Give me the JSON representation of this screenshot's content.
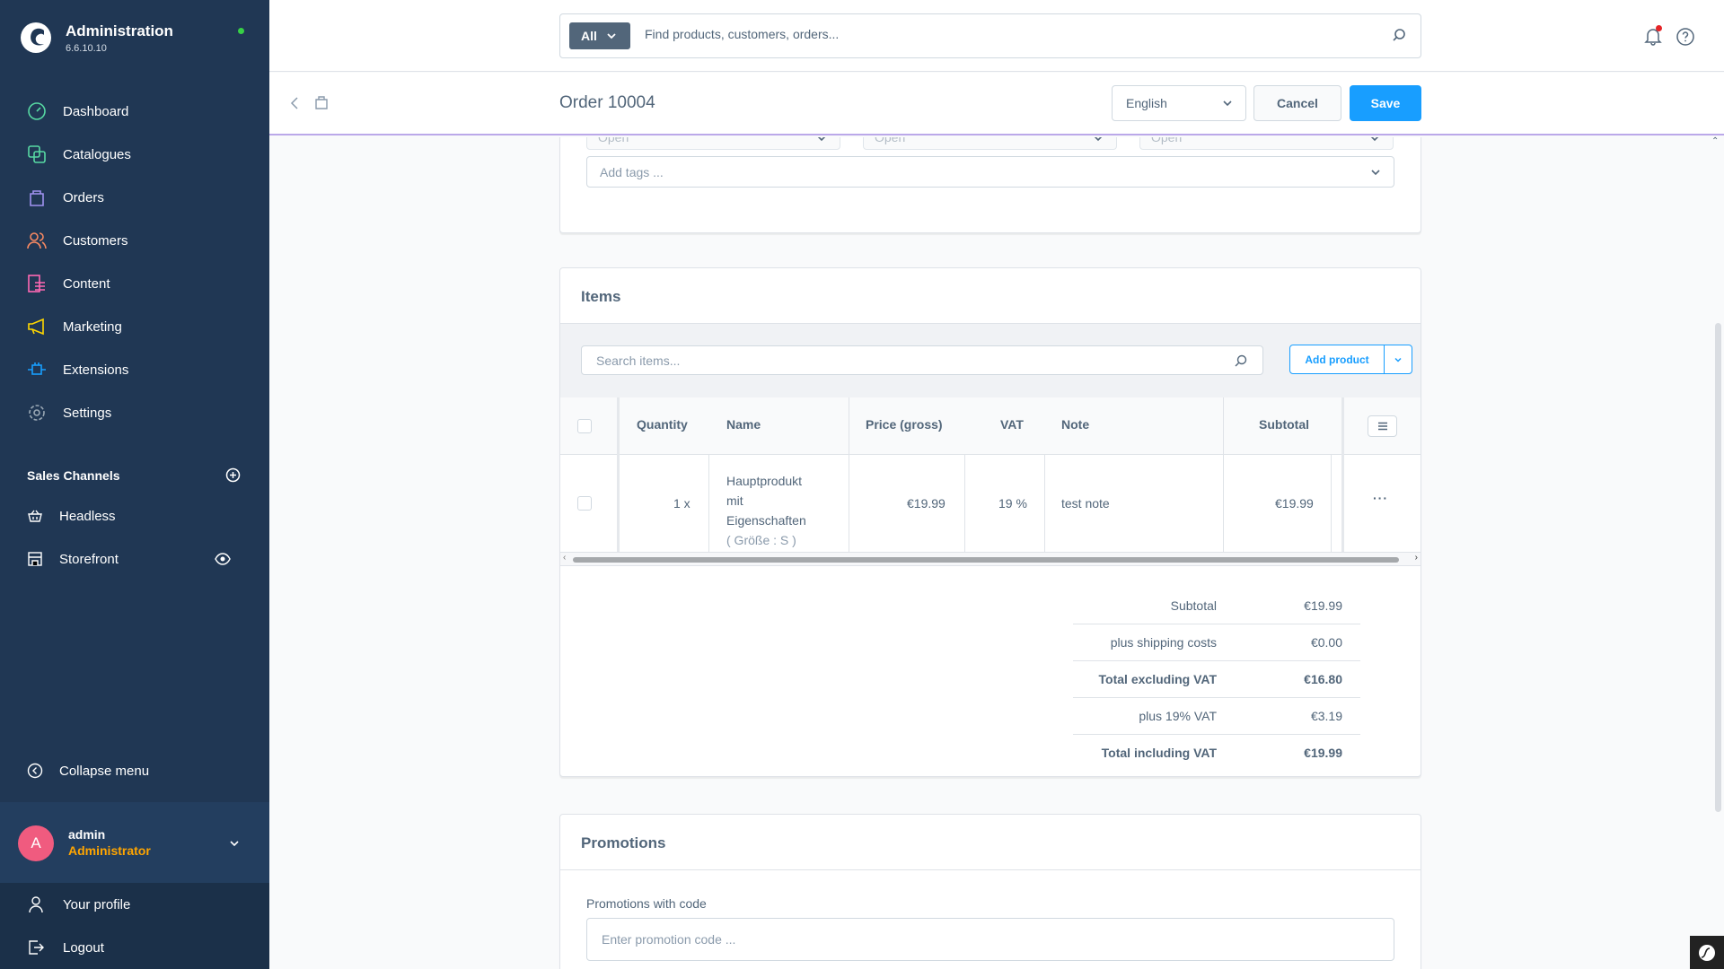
{
  "app": {
    "title": "Administration",
    "version": "6.6.10.10"
  },
  "sidebar": {
    "nav": [
      {
        "label": "Dashboard",
        "icon": "dashboard-icon",
        "color": "#57d9a3"
      },
      {
        "label": "Catalogues",
        "icon": "catalogues-icon",
        "color": "#57d9a3"
      },
      {
        "label": "Orders",
        "icon": "orders-icon",
        "color": "#a092f0"
      },
      {
        "label": "Customers",
        "icon": "customers-icon",
        "color": "#f88962"
      },
      {
        "label": "Content",
        "icon": "content-icon",
        "color": "#ff68b4"
      },
      {
        "label": "Marketing",
        "icon": "marketing-icon",
        "color": "#ffd700"
      },
      {
        "label": "Extensions",
        "icon": "extensions-icon",
        "color": "#189eff"
      },
      {
        "label": "Settings",
        "icon": "settings-icon",
        "color": "#9aa8b5"
      }
    ],
    "sales_channels_title": "Sales Channels",
    "sales_channels": [
      {
        "label": "Headless",
        "icon": "basket-icon"
      },
      {
        "label": "Storefront",
        "icon": "storefront-icon"
      }
    ],
    "collapse_label": "Collapse menu",
    "user": {
      "initial": "A",
      "name": "admin",
      "role": "Administrator"
    },
    "bottom_links": [
      {
        "label": "Your profile",
        "icon": "profile-icon"
      },
      {
        "label": "Logout",
        "icon": "logout-icon"
      }
    ]
  },
  "search": {
    "type_label": "All",
    "placeholder": "Find products, customers, orders..."
  },
  "smartbar": {
    "title": "Order 10004",
    "language": "English",
    "cancel_label": "Cancel",
    "save_label": "Save"
  },
  "status_card": {
    "statuses": [
      "Open",
      "Open",
      "Open"
    ],
    "tags_placeholder": "Add tags ..."
  },
  "items_card": {
    "title": "Items",
    "search_placeholder": "Search items...",
    "add_product_label": "Add product",
    "columns": {
      "quantity": "Quantity",
      "name": "Name",
      "price": "Price (gross)",
      "vat": "VAT",
      "note": "Note",
      "subtotal": "Subtotal"
    },
    "rows": [
      {
        "quantity": "1 x",
        "name_line1": "Hauptprodukt",
        "name_line2": "mit",
        "name_line3": "Eigenschaften",
        "variant": "( Größe : S )",
        "price": "€19.99",
        "vat": "19 %",
        "note": "test note",
        "subtotal": "€19.99",
        "actions": "···"
      }
    ],
    "summary": {
      "subtotal_label": "Subtotal",
      "subtotal": "€19.99",
      "shipping_label": "plus shipping costs",
      "shipping": "€0.00",
      "net_label": "Total excluding VAT",
      "net": "€16.80",
      "vat_label": "plus 19% VAT",
      "vat": "€3.19",
      "gross_label": "Total including VAT",
      "gross": "€19.99"
    }
  },
  "promotions_card": {
    "title": "Promotions",
    "code_label": "Promotions with code",
    "code_placeholder": "Enter promotion code ..."
  }
}
